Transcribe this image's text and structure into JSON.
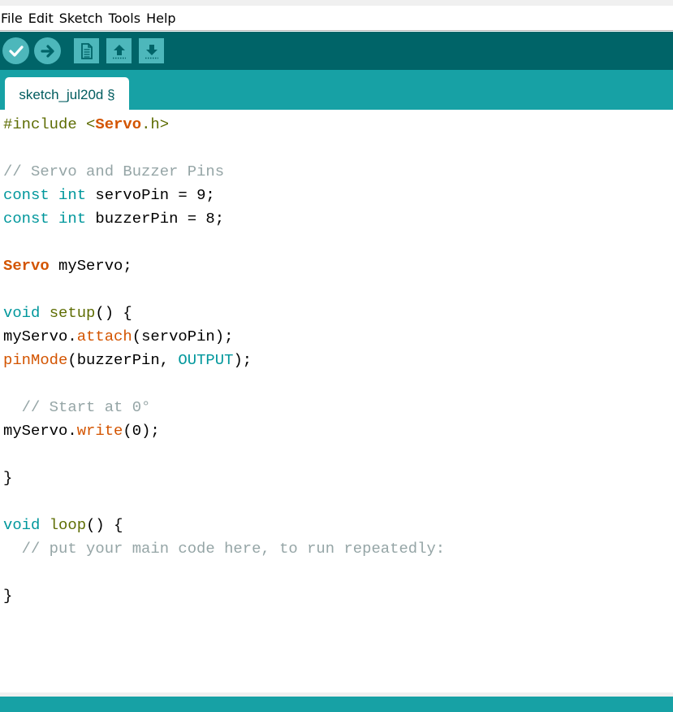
{
  "menu": {
    "file": "File",
    "edit": "Edit",
    "sketch": "Sketch",
    "tools": "Tools",
    "help": "Help"
  },
  "toolbar": {
    "buttons": [
      "verify-icon",
      "upload-arrow-icon",
      "new-file-icon",
      "open-arrow-up-icon",
      "save-arrow-down-icon"
    ]
  },
  "tab": {
    "label": "sketch_jul20d §"
  },
  "code": {
    "l1": {
      "a": "#include ",
      "b": "<",
      "c": "Servo",
      "d": ".h>"
    },
    "l2": {
      "a": "// Servo and Buzzer Pins"
    },
    "l3": {
      "a": "const",
      "b": " ",
      "c": "int",
      "d": " servoPin = 9;"
    },
    "l4": {
      "a": "const",
      "b": " ",
      "c": "int",
      "d": " buzzerPin = 8;"
    },
    "l5": {
      "a": "Servo",
      "b": " myServo;"
    },
    "l6": {
      "a": "void",
      "b": " ",
      "c": "setup",
      "d": "() {"
    },
    "l7": {
      "a": "myServo.",
      "b": "attach",
      "c": "(servoPin);"
    },
    "l8": {
      "a": "pinMode",
      "b": "(buzzerPin, ",
      "c": "OUTPUT",
      "d": ");"
    },
    "l9": {
      "a": "  // Start at 0°"
    },
    "l10": {
      "a": "myServo.",
      "b": "write",
      "c": "(0);"
    },
    "l11": {
      "a": "}"
    },
    "l12": {
      "a": "void",
      "b": " ",
      "c": "loop",
      "d": "() {"
    },
    "l13": {
      "a": "  // put your main code here, to run repeatedly:"
    },
    "l14": {
      "a": "}"
    }
  },
  "colors": {
    "toolbar_bg": "#006468",
    "tab_strip_bg": "#17a1a5",
    "button_fill": "#4db7bb",
    "keyword": "#00979c",
    "class_name": "#d35400",
    "comment": "#95a5a6",
    "function": "#5e6d03"
  }
}
